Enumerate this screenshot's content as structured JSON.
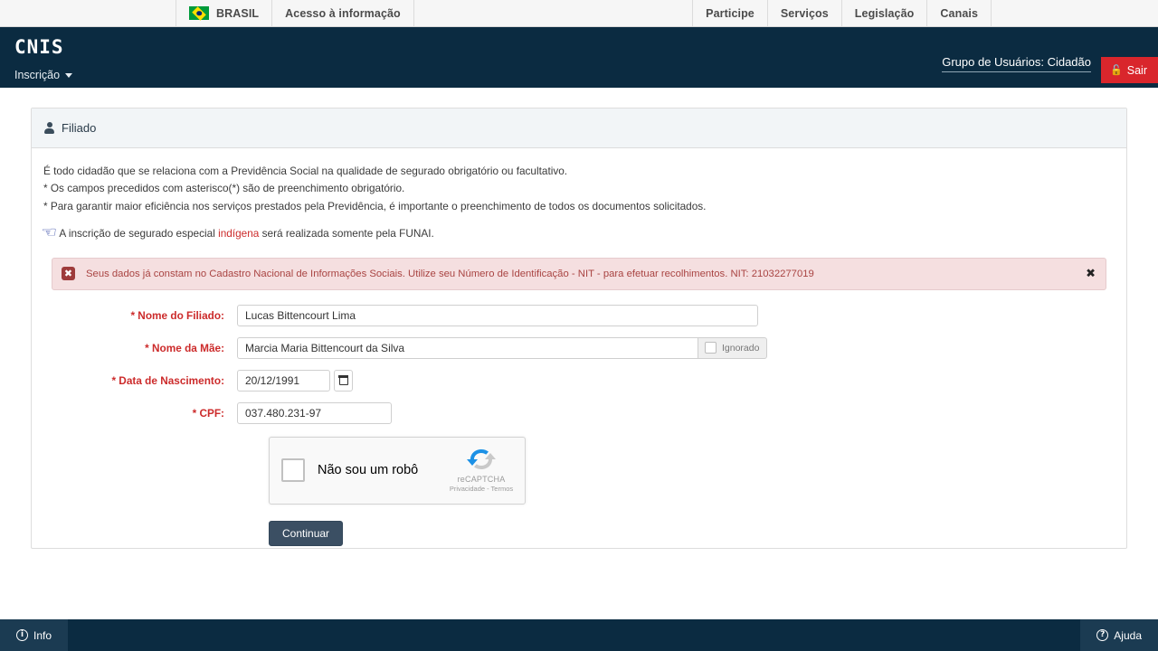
{
  "govbar": {
    "brasil_label": "BRASIL",
    "acesso_label": "Acesso à informação",
    "links": [
      {
        "label": "Participe"
      },
      {
        "label": "Serviços"
      },
      {
        "label": "Legislação"
      },
      {
        "label": "Canais"
      }
    ]
  },
  "header": {
    "brand": "CNIS",
    "user_group": "Grupo de Usuários: Cidadão",
    "logout_label": "Sair",
    "nav": [
      {
        "label": "Inscrição"
      }
    ]
  },
  "panel": {
    "title": "Filiado",
    "intro": {
      "line1": "É todo cidadão que se relaciona com a Previdência Social na qualidade de segurado obrigatório ou facultativo.",
      "line2": "* Os campos precedidos com asterisco(*) são de preenchimento obrigatório.",
      "line3": "* Para garantir maior eficiência nos serviços prestados pela Previdência, é importante o preenchimento de todos os documentos solicitados.",
      "funai_pre": "A inscrição de segurado especial ",
      "funai_red": "indígena",
      "funai_post": " será realizada somente pela FUNAI."
    }
  },
  "alert": {
    "message": "Seus dados já constam no Cadastro Nacional de Informações Sociais. Utilize seu Número de Identificação - NIT - para efetuar recolhimentos. NIT: 21032277019",
    "close_label": "✖",
    "icon_glyph": "✖",
    "bg_color": "#f5dfe0",
    "text_color": "#a94442"
  },
  "form": {
    "nome_filiado": {
      "label": "* Nome do Filiado:",
      "value": "Lucas Bittencourt Lima",
      "placeholder": ""
    },
    "nome_mae": {
      "label": "* Nome da Mãe:",
      "value": "Marcia Maria Bittencourt da Silva",
      "placeholder": "",
      "ignorado_label": "Ignorado"
    },
    "data_nascimento": {
      "label": "* Data de Nascimento:",
      "value": "20/12/1991",
      "placeholder": ""
    },
    "cpf": {
      "label": "* CPF:",
      "value": "037.480.231-97",
      "placeholder": ""
    },
    "recaptcha": {
      "label": "Não sou um robô",
      "brand": "reCAPTCHA",
      "links": "Privacidade - Termos"
    },
    "submit_label": "Continuar"
  },
  "footer": {
    "info_label": "Info",
    "info_icon": "i",
    "ajuda_label": "Ajuda",
    "ajuda_icon": "?"
  }
}
